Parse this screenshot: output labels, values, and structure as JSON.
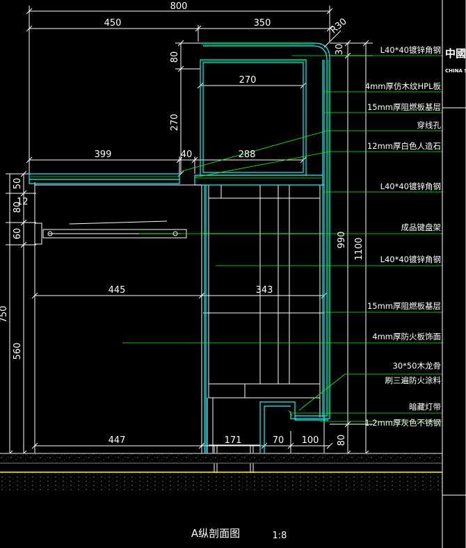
{
  "drawing": {
    "title": "A纵剖面图",
    "scale": "1:8",
    "logo_main": "中國",
    "logo_sub": "CHINA S",
    "colors": {
      "background": "#000000",
      "dim_line": "#ffffff",
      "leader": "#00ff00",
      "panel": "#00ffff",
      "frame": "#ffffff",
      "ground_top": "#a0a0a0",
      "ground_line": "#ffff00"
    }
  },
  "dimensions": {
    "top_total": "800",
    "top_left": "450",
    "top_right": "350",
    "radius": "R30",
    "inner_width": "270",
    "upper_height": "270",
    "h80_top": "80",
    "upper_left": "399",
    "gap40": "40",
    "upper_right": "288",
    "v50": "50",
    "v80": "80",
    "v12": "12",
    "v60": "60",
    "v750": "750",
    "v560": "560",
    "mid_left": "445",
    "mid_right": "343",
    "bottom_left": "447",
    "bottom_171": "171",
    "bottom_70": "70",
    "bottom_100": "100",
    "v30_right": "30",
    "v990": "990",
    "v1100": "1100",
    "v80_bottom": "80"
  },
  "notes": [
    "L40*40镀锌角钢",
    "4mm厚仿木纹HPL板",
    "15mm厚阻燃板基层",
    "穿线孔",
    "12mm厚白色人造石",
    "L40*40镀锌角钢",
    "成品键盘架",
    "L40*40镀锌角钢",
    "15mm厚阻燃板基层",
    "4mm厚防火板饰面",
    "30*50木龙骨",
    "刷三遍防火涂料",
    "暗藏灯带",
    "1.2mm厚灰色不锈钢"
  ]
}
